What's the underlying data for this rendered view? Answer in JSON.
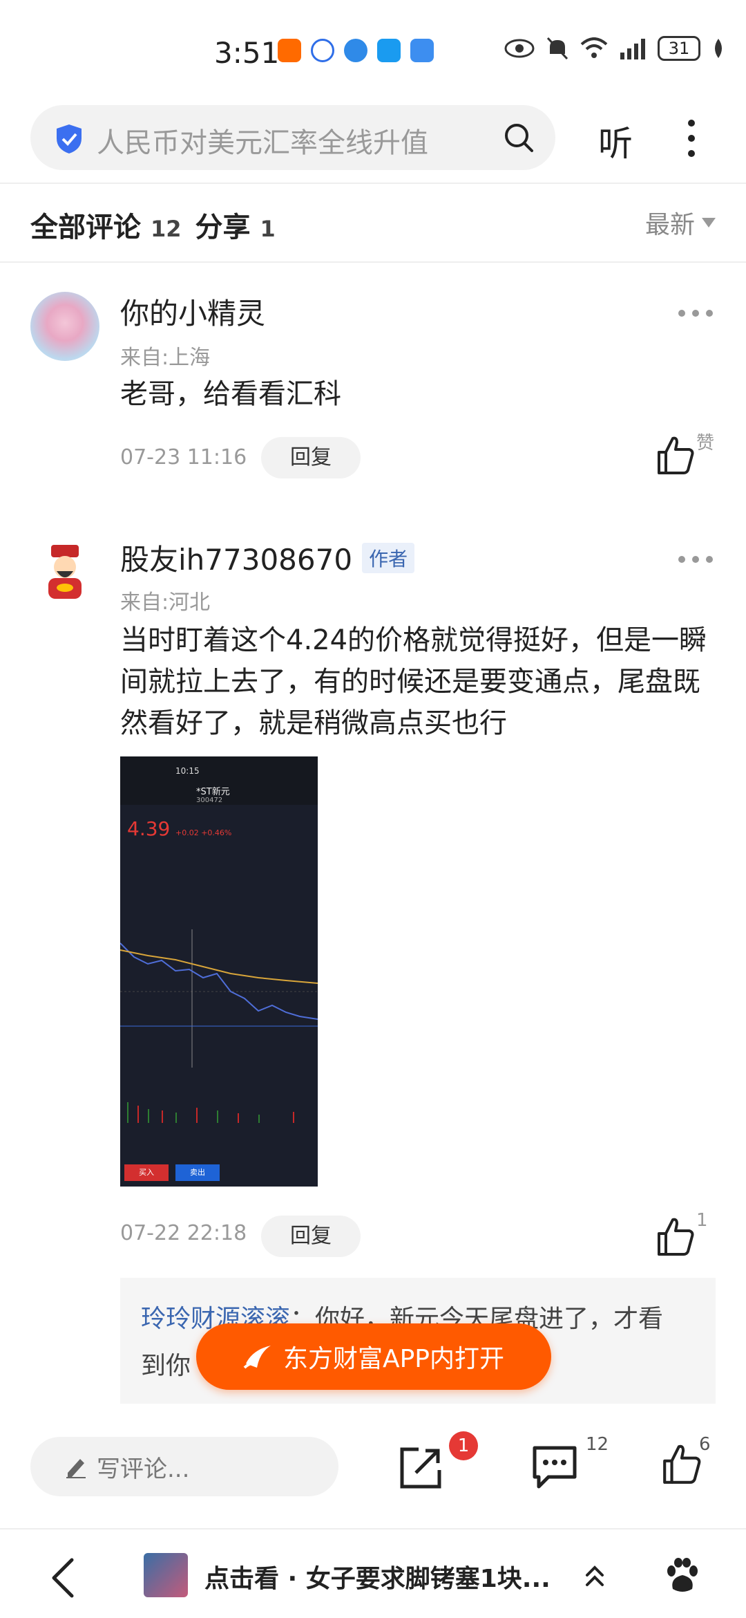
{
  "status_bar": {
    "time": "3:51",
    "battery": "31"
  },
  "search": {
    "query": "人民币对美元汇率全线升值",
    "listen_label": "听"
  },
  "tabs": {
    "comments_label": "全部评论",
    "comments_count": "12",
    "share_label": "分享",
    "share_count": "1",
    "sort_label": "最新"
  },
  "comments": [
    {
      "name": "你的小精灵",
      "from": "来自:上海",
      "text": "老哥，给看看汇科",
      "time": "07-23 11:16",
      "reply_label": "回复",
      "like_label": "赞"
    },
    {
      "name": "股友ih77308670",
      "author_tag": "作者",
      "from": "来自:河北",
      "text": "当时盯着这个4.24的价格就觉得挺好，但是一瞬间就拉上去了，有的时候还是要变通点，尾盘既然看好了，就是稍微高点买也行",
      "time": "07-22 22:18",
      "reply_label": "回复",
      "like_count": "1",
      "nested_user": "玲玲财源滚滚",
      "nested_text_1": "：你好，新元今天尾盘进了，才看",
      "nested_text_2": "到你"
    }
  ],
  "screenshot": {
    "time": "10:15",
    "name": "*ST新元",
    "code": "300472",
    "price": "4.39",
    "change": "+0.02 +0.46%",
    "buy": "买入",
    "sell": "卖出"
  },
  "open_app_label": "东方财富APP内打开",
  "bottom_bar": {
    "write_placeholder": "写评论...",
    "share_badge": "1",
    "comment_count": "12",
    "like_count": "6"
  },
  "nav": {
    "title": "点击看 · 女子要求脚铐塞1块..."
  },
  "colors": {
    "accent_orange": "#ff5a00",
    "link_blue": "#3a66b0",
    "badge_red": "#e53935"
  }
}
